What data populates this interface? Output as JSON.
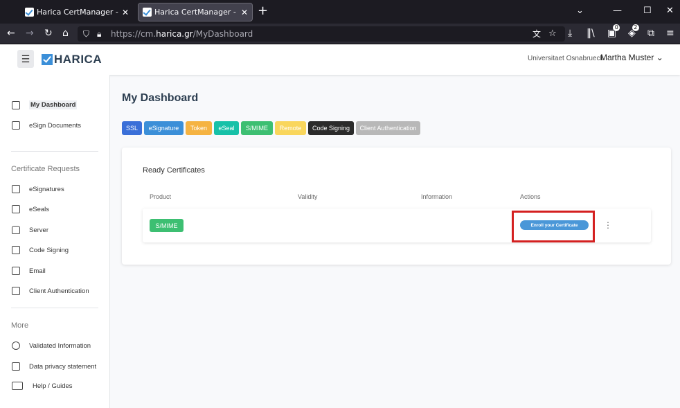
{
  "browser": {
    "tabs": [
      {
        "title": "Harica CertManager - My Dashb"
      },
      {
        "title": "Harica CertManager - My Dashb"
      }
    ],
    "new_tab": "+",
    "window_controls": {
      "minimize": "⌄",
      "min": "—",
      "max": "☐",
      "close": "✕"
    },
    "url_prefix": "https://cm.",
    "url_domain": "harica.gr",
    "url_path": "/MyDashboard",
    "badges": {
      "first": "0",
      "second": "2"
    }
  },
  "header": {
    "menu_icon": "☰",
    "logo_text": "HARICA",
    "organization": "Universitaet Osnabrueck",
    "user_name": "Martha Muster",
    "user_caret": "⌄"
  },
  "sidebar": {
    "top_items": [
      {
        "label": "My Dashboard",
        "icon": "dashboard-icon"
      },
      {
        "label": "eSign Documents",
        "icon": "esign-icon"
      }
    ],
    "section_requests": "Certificate Requests",
    "request_items": [
      {
        "label": "eSignatures",
        "icon": "signature-icon"
      },
      {
        "label": "eSeals",
        "icon": "seal-icon"
      },
      {
        "label": "Server",
        "icon": "lock-icon"
      },
      {
        "label": "Code Signing",
        "icon": "code-icon"
      },
      {
        "label": "Email",
        "icon": "email-icon"
      },
      {
        "label": "Client Authentication",
        "icon": "client-icon"
      }
    ],
    "section_more": "More",
    "more_items": [
      {
        "label": "Validated Information",
        "icon": "anchor-icon"
      },
      {
        "label": "Data privacy statement",
        "icon": "privacy-icon"
      },
      {
        "label": "Help / Guides",
        "icon": "help-icon"
      }
    ]
  },
  "main": {
    "title": "My Dashboard",
    "chips": [
      {
        "label": "SSL",
        "color": "#3a6fd8"
      },
      {
        "label": "eSignature",
        "color": "#3b8fd8"
      },
      {
        "label": "Token",
        "color": "#f5b342"
      },
      {
        "label": "eSeal",
        "color": "#17c1a8"
      },
      {
        "label": "S/MIME",
        "color": "#3dbf72"
      },
      {
        "label": "Remote",
        "color": "#f9d65c"
      },
      {
        "label": "Code Signing",
        "color": "#2b2b2b"
      },
      {
        "label": "Client Authentication",
        "color": "#b8b8b8"
      }
    ],
    "card_title": "Ready Certificates",
    "columns": [
      "Product",
      "Validity",
      "Information",
      "Actions"
    ],
    "row": {
      "product": "S/MIME",
      "action_button": "Enroll your Certificate",
      "more_icon": "⋮"
    }
  }
}
